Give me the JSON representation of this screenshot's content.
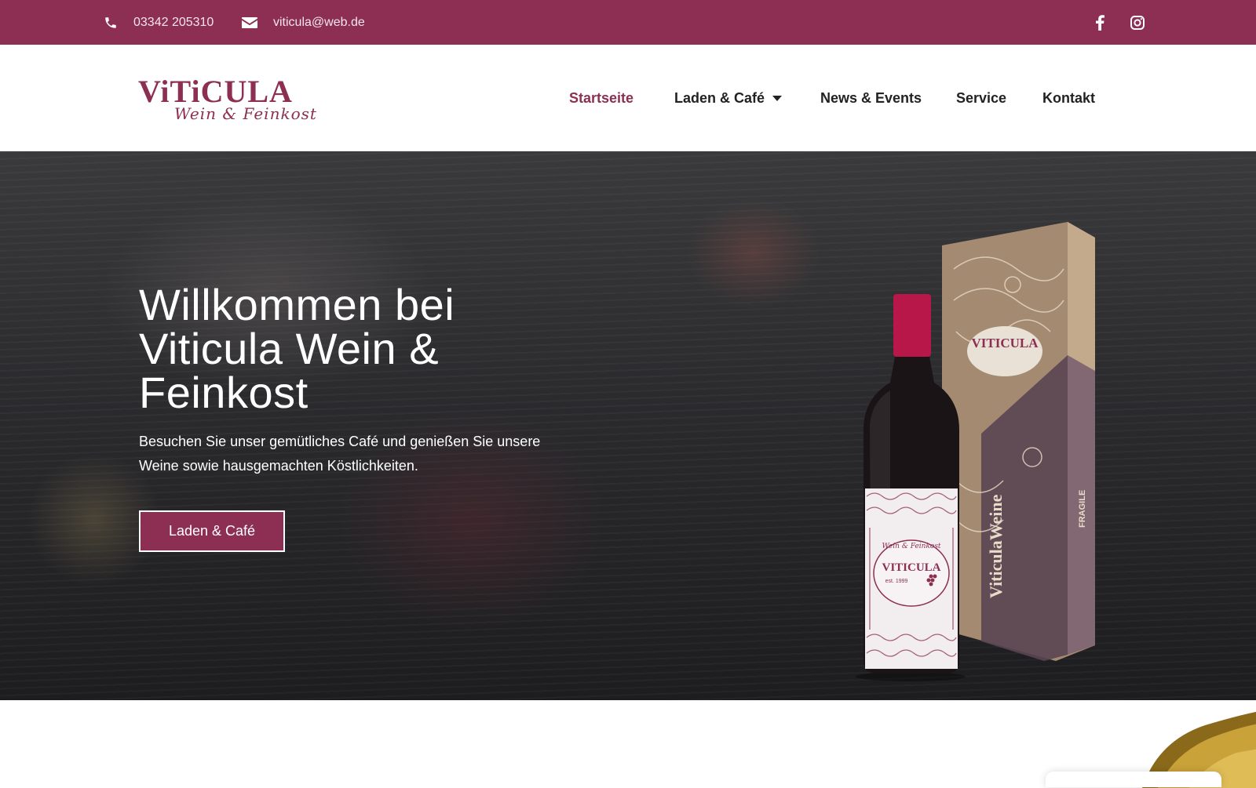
{
  "topbar": {
    "phone": "03342 205310",
    "email": "viticula@web.de",
    "icons": {
      "phone": "phone-icon",
      "email": "envelope-icon",
      "facebook": "facebook-icon",
      "instagram": "instagram-icon"
    },
    "background": "#8c2f52"
  },
  "header": {
    "logo": {
      "brand": "ViTiCULA",
      "sub": "Wein & Feinkost"
    },
    "nav": [
      {
        "label": "Startseite",
        "active": true
      },
      {
        "label": "Laden & Café",
        "has_dropdown": true
      },
      {
        "label": "News & Events"
      },
      {
        "label": "Service"
      },
      {
        "label": "Kontakt"
      }
    ]
  },
  "hero": {
    "title": "Willkommen bei Viticula Wein & Feinkost",
    "text": "Besuchen Sie unser gemütliches Café und genießen Sie unsere Weine sowie hausgemachten Köstlichkeiten.",
    "button": "Laden & Café",
    "product": {
      "box_brand": "VITICULA",
      "box_side_text": "ViticulaWeine",
      "box_fragile": "FRAGILE",
      "label_top": "Wein & Feinkost",
      "label_brand": "VITICULA",
      "label_est": "est. 1999"
    }
  },
  "colors": {
    "accent": "#8c2f52",
    "text_dark": "#222222",
    "white": "#ffffff"
  }
}
